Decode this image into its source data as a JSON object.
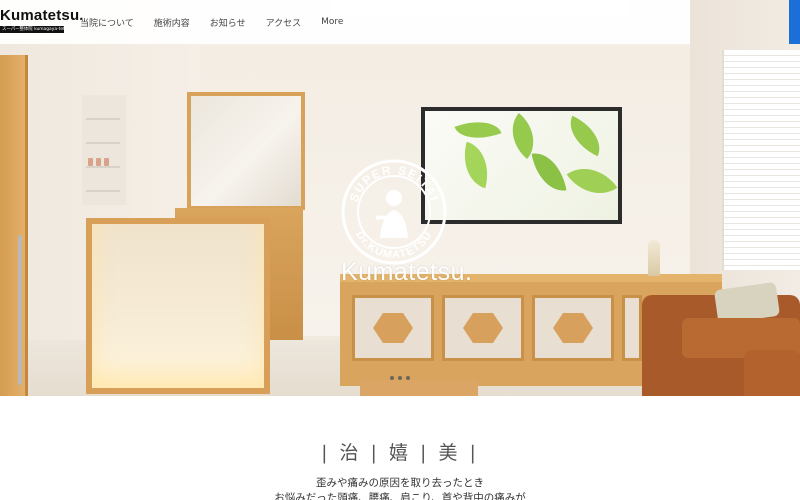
{
  "header": {
    "logo_text": "Kumatetsu.",
    "logo_subtext": "スーパー整体院 kumagaya-tetsuyasu",
    "nav": [
      {
        "label": "当院について"
      },
      {
        "label": "施術内容"
      },
      {
        "label": "お知らせ"
      },
      {
        "label": "アクセス"
      },
      {
        "label": "More"
      }
    ],
    "accent_color": "#1b6fd6"
  },
  "hero": {
    "emblem_ring_top": "SUPER SEITAI",
    "emblem_ring_bottom": "Dr.KUMATETSU",
    "wordmark": "Kumatetsu.",
    "slider": {
      "slide_count": 3,
      "active_index": 0
    }
  },
  "intro": {
    "title": "| 治 | 嬉 | 美 |",
    "lines": [
      "歪みや痛みの原因を取り去ったとき",
      "お悩みだった頭痛、腰痛、肩こり、首や背中の痛みが"
    ]
  },
  "icons": {
    "emblem": "clinic-emblem-icon"
  }
}
